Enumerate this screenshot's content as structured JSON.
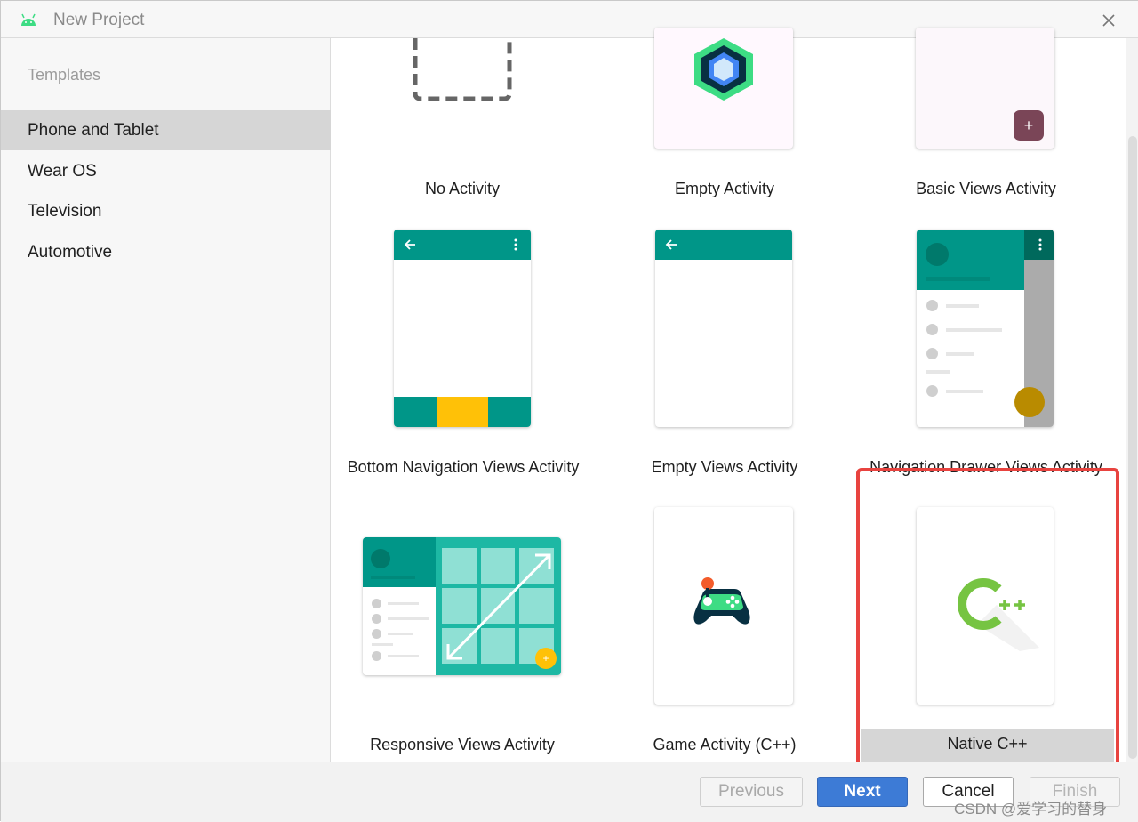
{
  "window": {
    "title": "New Project",
    "close_icon": "close-icon",
    "app_icon": "android-icon"
  },
  "sidebar": {
    "header": "Templates",
    "items": [
      {
        "label": "Phone and Tablet",
        "selected": true
      },
      {
        "label": "Wear OS",
        "selected": false
      },
      {
        "label": "Television",
        "selected": false
      },
      {
        "label": "Automotive",
        "selected": false
      }
    ]
  },
  "templates": [
    {
      "label": "No Activity"
    },
    {
      "label": "Empty Activity"
    },
    {
      "label": "Basic Views Activity"
    },
    {
      "label": "Bottom Navigation Views Activity"
    },
    {
      "label": "Empty Views Activity"
    },
    {
      "label": "Navigation Drawer Views Activity"
    },
    {
      "label": "Responsive Views Activity"
    },
    {
      "label": "Game Activity (C++)"
    },
    {
      "label": "Native C++",
      "selected": true
    }
  ],
  "footer": {
    "previous_label": "Previous",
    "next_label": "Next",
    "cancel_label": "Cancel",
    "finish_label": "Finish"
  },
  "watermark": "CSDN @爱学习的替身",
  "colors": {
    "accent": "#3d7bd6",
    "teal": "#009688",
    "highlight": "#e8433f",
    "yellow": "#ffc107",
    "cpp_green": "#76c442"
  }
}
